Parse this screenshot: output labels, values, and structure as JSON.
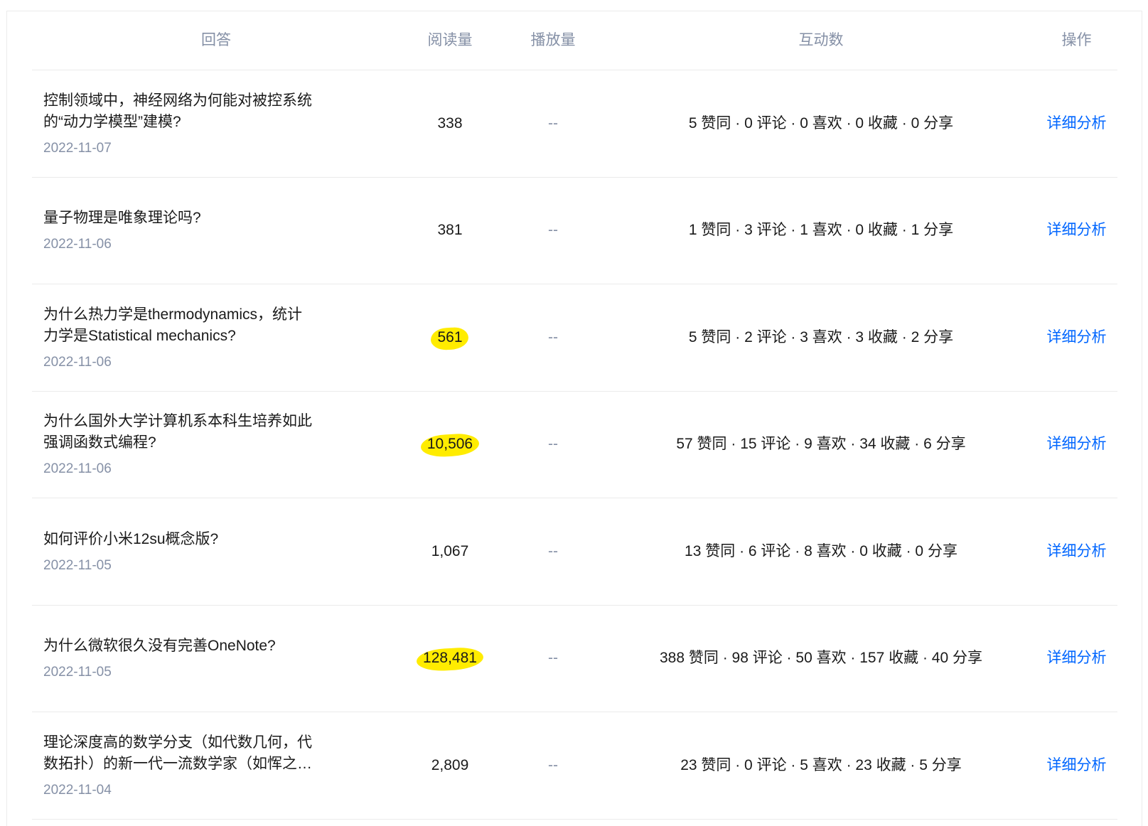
{
  "table": {
    "headers": {
      "answer": "回答",
      "reads": "阅读量",
      "plays": "播放量",
      "interactions": "互动数",
      "actions": "操作"
    },
    "rows": [
      {
        "title_lines": [
          "控制领域中，神经网络为何能对被控系统",
          "的“动力学模型”建模?"
        ],
        "date": "2022-11-07",
        "reads": "338",
        "reads_highlighted": false,
        "plays": "--",
        "interactions": "5 赞同 · 0 评论 · 0 喜欢 · 0 收藏 · 0 分享",
        "action": "详细分析"
      },
      {
        "title_lines": [
          "量子物理是唯象理论吗?"
        ],
        "date": "2022-11-06",
        "reads": "381",
        "reads_highlighted": false,
        "plays": "--",
        "interactions": "1 赞同 · 3 评论 · 1 喜欢 · 0 收藏 · 1 分享",
        "action": "详细分析"
      },
      {
        "title_lines": [
          "为什么热力学是thermodynamics，统计",
          "力学是Statistical mechanics?"
        ],
        "date": "2022-11-06",
        "reads": "561",
        "reads_highlighted": true,
        "plays": "--",
        "interactions": "5 赞同 · 2 评论 · 3 喜欢 · 3 收藏 · 2 分享",
        "action": "详细分析"
      },
      {
        "title_lines": [
          "为什么国外大学计算机系本科生培养如此",
          "强调函数式编程?"
        ],
        "date": "2022-11-06",
        "reads": "10,506",
        "reads_highlighted": true,
        "plays": "--",
        "interactions": "57 赞同 · 15 评论 · 9 喜欢 · 34 收藏 · 6 分享",
        "action": "详细分析"
      },
      {
        "title_lines": [
          "如何评价小米12su概念版?"
        ],
        "date": "2022-11-05",
        "reads": "1,067",
        "reads_highlighted": false,
        "plays": "--",
        "interactions": "13 赞同 · 6 评论 · 8 喜欢 · 0 收藏 · 0 分享",
        "action": "详细分析"
      },
      {
        "title_lines": [
          "为什么微软很久没有完善OneNote?"
        ],
        "date": "2022-11-05",
        "reads": "128,481",
        "reads_highlighted": true,
        "plays": "--",
        "interactions": "388 赞同 · 98 评论 · 50 喜欢 · 157 收藏 · 40 分享",
        "action": "详细分析"
      },
      {
        "title_lines": [
          "理论深度高的数学分支（如代数几何，代",
          "数拓扑）的新一代一流数学家（如恽之…"
        ],
        "date": "2022-11-04",
        "reads": "2,809",
        "reads_highlighted": false,
        "plays": "--",
        "interactions": "23 赞同 · 0 评论 · 5 喜欢 · 23 收藏 · 5 分享",
        "action": "详细分析"
      }
    ]
  },
  "colors": {
    "header_text": "#8590a6",
    "text": "#1a1a1a",
    "link": "#0066ff",
    "highlight": "#ffec00",
    "divider": "#ebebeb"
  }
}
